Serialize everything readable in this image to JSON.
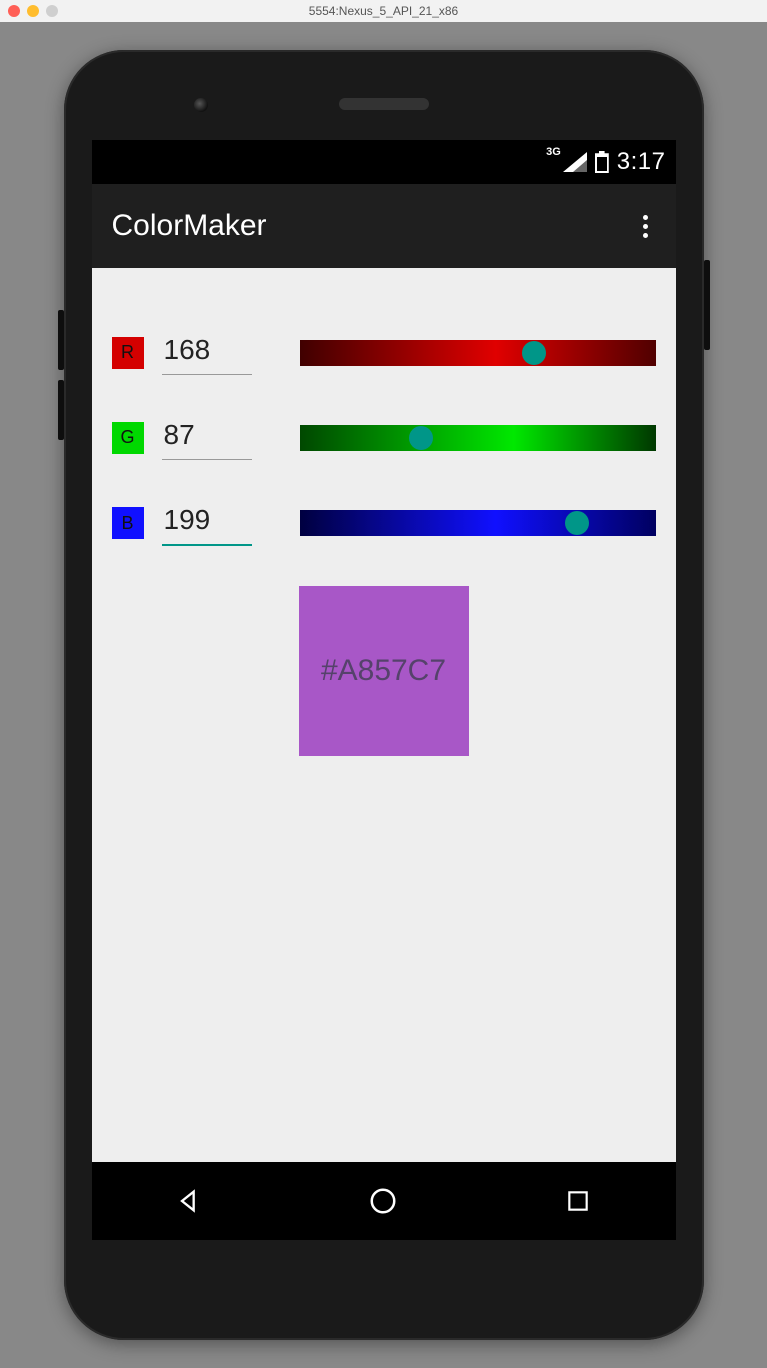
{
  "mac_window": {
    "title": "5554:Nexus_5_API_21_x86"
  },
  "status_bar": {
    "network_label": "3G",
    "time": "3:17"
  },
  "app_bar": {
    "title": "ColorMaker"
  },
  "channels": {
    "r": {
      "label": "R",
      "value": "168",
      "slider_pct": 66,
      "chip_color": "#d40000"
    },
    "g": {
      "label": "G",
      "value": "87",
      "slider_pct": 34,
      "chip_color": "#00d800"
    },
    "b": {
      "label": "B",
      "value": "199",
      "slider_pct": 78,
      "chip_color": "#1010ff"
    }
  },
  "swatch": {
    "hex": "#A857C7",
    "bg": "#A857C7",
    "text_color": "#55426b"
  }
}
